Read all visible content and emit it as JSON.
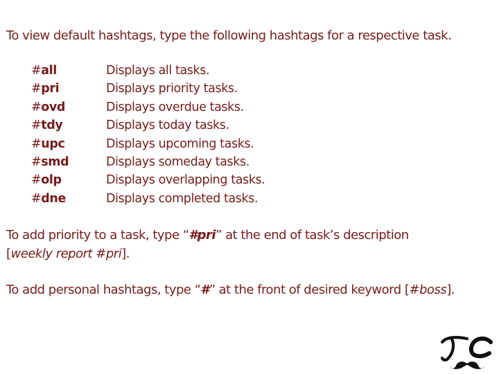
{
  "intro": "To view default hashtags, type the following hashtags for a respective task.",
  "hashtags": [
    {
      "hash": "#",
      "code": "all",
      "desc": "Displays all tasks."
    },
    {
      "hash": "#",
      "code": "pri",
      "desc": "Displays priority tasks."
    },
    {
      "hash": "#",
      "code": "ovd",
      "desc": "Displays overdue tasks."
    },
    {
      "hash": "#",
      "code": "tdy",
      "desc": "Displays today tasks."
    },
    {
      "hash": "#",
      "code": "upc",
      "desc": "Displays upcoming tasks."
    },
    {
      "hash": "#",
      "code": "smd",
      "desc": "Displays someday tasks."
    },
    {
      "hash": "#",
      "code": "olp",
      "desc": "Displays overlapping tasks."
    },
    {
      "hash": "#",
      "code": "dne",
      "desc": "Displays completed tasks."
    }
  ],
  "priority": {
    "before": "To add priority to a task, type “",
    "tag": "#pri",
    "after": "” at the end of task’s description",
    "example_open": "[",
    "example": "weekly report #pri",
    "example_close": "]."
  },
  "personal": {
    "before": "To add personal hashtags, type “",
    "tag": "#",
    "after": "” at the front of desired keyword [",
    "example": "#boss",
    "example_close": "]."
  },
  "logo": {
    "text": "TC",
    "icon": "mustache-icon",
    "color": "#111111"
  },
  "colors": {
    "text": "#7a1a1a",
    "background": "#ffffff"
  }
}
